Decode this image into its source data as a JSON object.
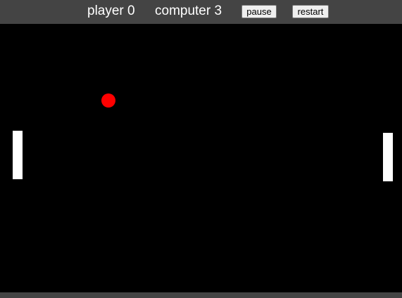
{
  "scoreboard": {
    "player_label": "player 0",
    "computer_label": "computer 3"
  },
  "controls": {
    "pause_label": "pause",
    "restart_label": "restart"
  },
  "game": {
    "player_score": 0,
    "computer_score": 3,
    "colors": {
      "background": "#000000",
      "toolbar": "#444444",
      "paddle": "#ffffff",
      "ball": "#ff0000",
      "score_text": "#ffffff"
    }
  }
}
